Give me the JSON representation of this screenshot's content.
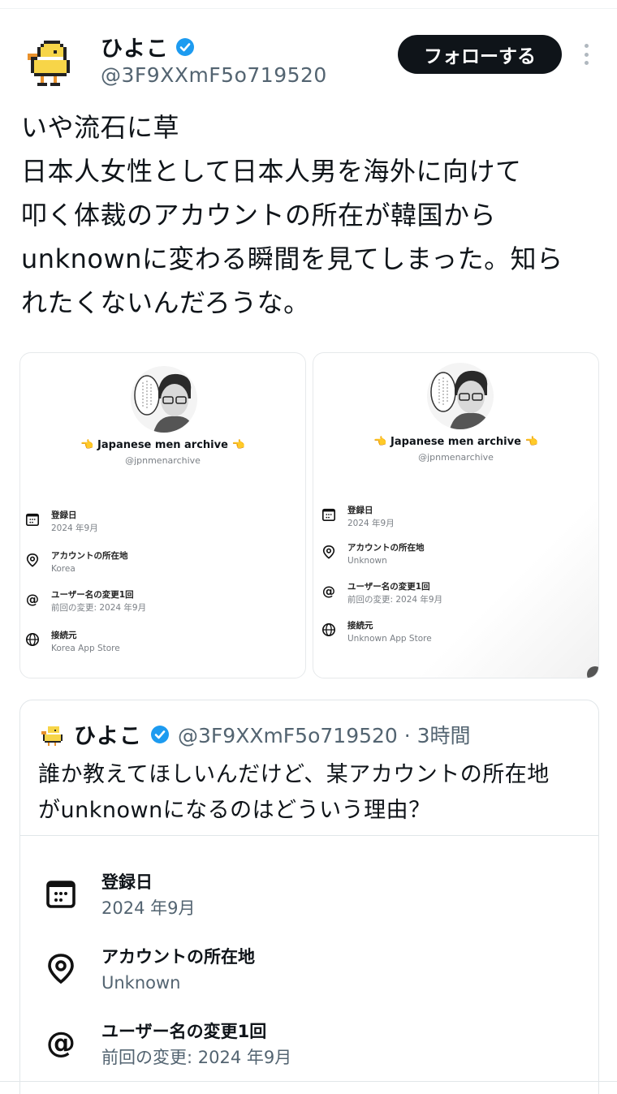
{
  "post": {
    "author": {
      "display_name": "ひよこ",
      "handle": "@3F9XXmF5o719520",
      "verified": true
    },
    "follow_label": "フォローする",
    "text": "いや流石に草\n日本人女性として日本人男を海外に向けて\n叩く体裁のアカウントの所在が韓国から\nunknownに変わる瞬間を見てしまった。知ら\nれたくないんだろうな。"
  },
  "media": {
    "left": {
      "profile_name": "👈 Japanese men archive 👈",
      "profile_handle": "@jpnmenarchive",
      "rows": [
        {
          "icon": "calendar-icon",
          "label": "登録日",
          "value": "2024 年9月"
        },
        {
          "icon": "location-pin-icon",
          "label": "アカウントの所在地",
          "value": "Korea"
        },
        {
          "icon": "at-sign-icon",
          "label": "ユーザー名の変更1回",
          "value": "前回の変更: 2024 年9月"
        },
        {
          "icon": "globe-icon",
          "label": "接続元",
          "value": "Korea App Store"
        }
      ]
    },
    "right": {
      "profile_name": "👈 Japanese men archive 👈",
      "profile_handle": "@jpnmenarchive",
      "rows": [
        {
          "icon": "calendar-icon",
          "label": "登録日",
          "value": "2024 年9月"
        },
        {
          "icon": "location-pin-icon",
          "label": "アカウントの所在地",
          "value": "Unknown"
        },
        {
          "icon": "at-sign-icon",
          "label": "ユーザー名の変更1回",
          "value": "前回の変更: 2024 年9月"
        },
        {
          "icon": "globe-icon",
          "label": "接続元",
          "value": "Unknown App Store"
        }
      ]
    }
  },
  "quote": {
    "author": {
      "display_name": "ひよこ",
      "handle": "@3F9XXmF5o719520 · 3時間",
      "verified": true
    },
    "text": "誰か教えてほしいんだけど、某アカウントの所在地\nがunknownになるのはどういう理由？",
    "rows": [
      {
        "icon": "calendar-icon",
        "label": "登録日",
        "value": "2024 年9月"
      },
      {
        "icon": "location-pin-icon",
        "label": "アカウントの所在地",
        "value": "Unknown"
      },
      {
        "icon": "at-sign-icon",
        "label": "ユーザー名の変更1回",
        "value": "前回の変更: 2024 年9月"
      }
    ]
  },
  "colors": {
    "verified": "#1d9bf0",
    "text": "#0f1419",
    "secondary": "#536471",
    "chick": "#f7d548"
  }
}
